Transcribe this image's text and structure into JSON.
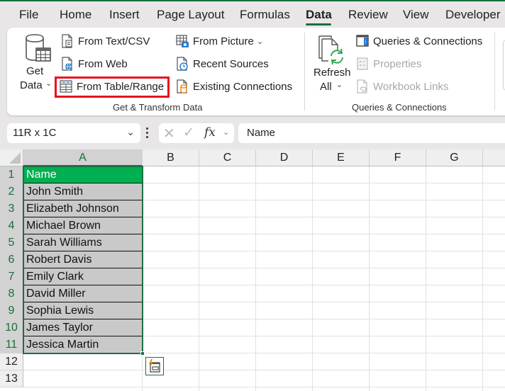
{
  "ribbon_tabs": [
    {
      "label": "File"
    },
    {
      "label": "Home"
    },
    {
      "label": "Insert"
    },
    {
      "label": "Page Layout"
    },
    {
      "label": "Formulas"
    },
    {
      "label": "Data",
      "active": true
    },
    {
      "label": "Review"
    },
    {
      "label": "View"
    },
    {
      "label": "Developer"
    }
  ],
  "get_transform": {
    "get_data_line1": "Get",
    "get_data_line2": "Data",
    "from_text_csv": "From Text/CSV",
    "from_web": "From Web",
    "from_table_range": "From Table/Range",
    "from_picture": "From Picture",
    "recent_sources": "Recent Sources",
    "existing_connections": "Existing Connections",
    "group_label": "Get & Transform Data"
  },
  "queries": {
    "refresh_line1": "Refresh",
    "refresh_line2": "All",
    "queries_connections": "Queries & Connections",
    "properties": "Properties",
    "workbook_links": "Workbook Links",
    "group_label": "Queries & Connections"
  },
  "highlight_color": "#e8101d",
  "formula_bar": {
    "name_box": "11R x 1C",
    "cancel_icon": "✕",
    "enter_icon": "✓",
    "fx_label": "fx",
    "formula": "Name"
  },
  "columns": [
    "A",
    "B",
    "C",
    "D",
    "E",
    "F",
    "G"
  ],
  "rows": [
    "1",
    "2",
    "3",
    "4",
    "5",
    "6",
    "7",
    "8",
    "9",
    "10",
    "11",
    "12",
    "13"
  ],
  "column_a": [
    "Name",
    "John Smith",
    "Elizabeth Johnson",
    "Michael Brown",
    "Sarah Williams",
    "Robert Davis",
    "Emily Clark",
    "David Miller",
    "Sophia Lewis",
    "James Taylor",
    "Jessica Martin"
  ],
  "colors": {
    "accent": "#1b6e3a",
    "header_fill": "#00b050",
    "data_fill": "#c9c9c9"
  }
}
